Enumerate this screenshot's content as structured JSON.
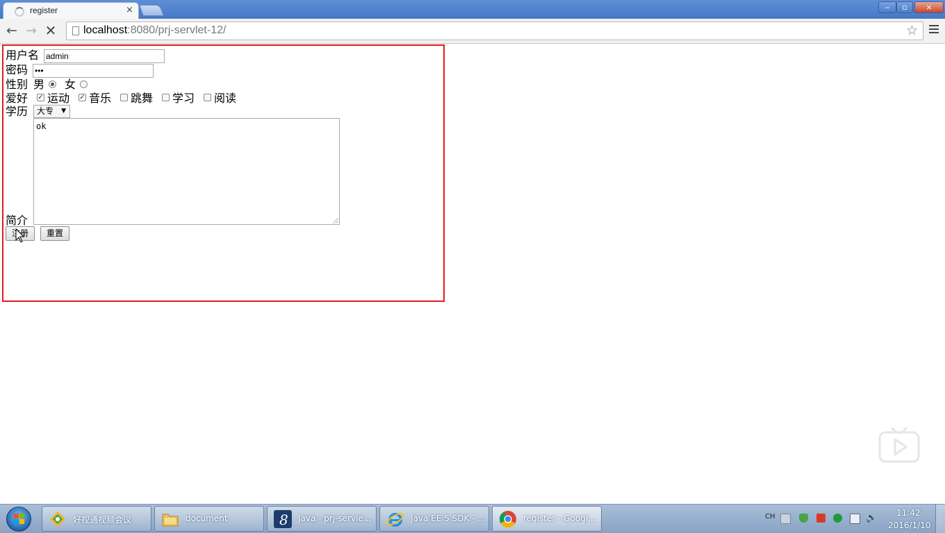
{
  "browser": {
    "tab_title": "register",
    "tab_close": "×",
    "url_host": "localhost",
    "url_rest": ":8080/prj-servlet-12/",
    "window_controls": {
      "minimize": "‒",
      "maximize": "▫",
      "close": "×"
    }
  },
  "form": {
    "username_label": "用户名",
    "username_value": "admin",
    "password_label": "密码",
    "password_value": "•••",
    "gender_label": "性别",
    "gender_options": [
      {
        "label": "男",
        "checked": true
      },
      {
        "label": "女",
        "checked": false
      }
    ],
    "hobby_label": "爱好",
    "hobbies": [
      {
        "label": "运动",
        "checked": true
      },
      {
        "label": "音乐",
        "checked": true
      },
      {
        "label": "跳舞",
        "checked": false
      },
      {
        "label": "学习",
        "checked": false
      },
      {
        "label": "阅读",
        "checked": false
      }
    ],
    "education_label": "学历",
    "education_selected": "大专",
    "intro_label": "简介",
    "intro_value": "ok",
    "submit_label": "注册",
    "reset_label": "重置"
  },
  "taskbar": {
    "items": [
      {
        "label": "好视通视频会议",
        "icon": "videoconf-icon"
      },
      {
        "label": "document",
        "icon": "folder-icon"
      },
      {
        "label": "Java - prj-servle...",
        "icon": "eclipse-icon"
      },
      {
        "label": "Java EE 5 SDK - ...",
        "icon": "ie-icon"
      },
      {
        "label": "register - Googl...",
        "icon": "chrome-icon",
        "active": true
      }
    ],
    "tray_lang": "CH",
    "clock_time": "11:42",
    "clock_date": "2016/1/10"
  },
  "colors": {
    "frame_border": "#e01b1b",
    "titlebar": "#4f82cc",
    "taskbar": "#9db4d2"
  }
}
